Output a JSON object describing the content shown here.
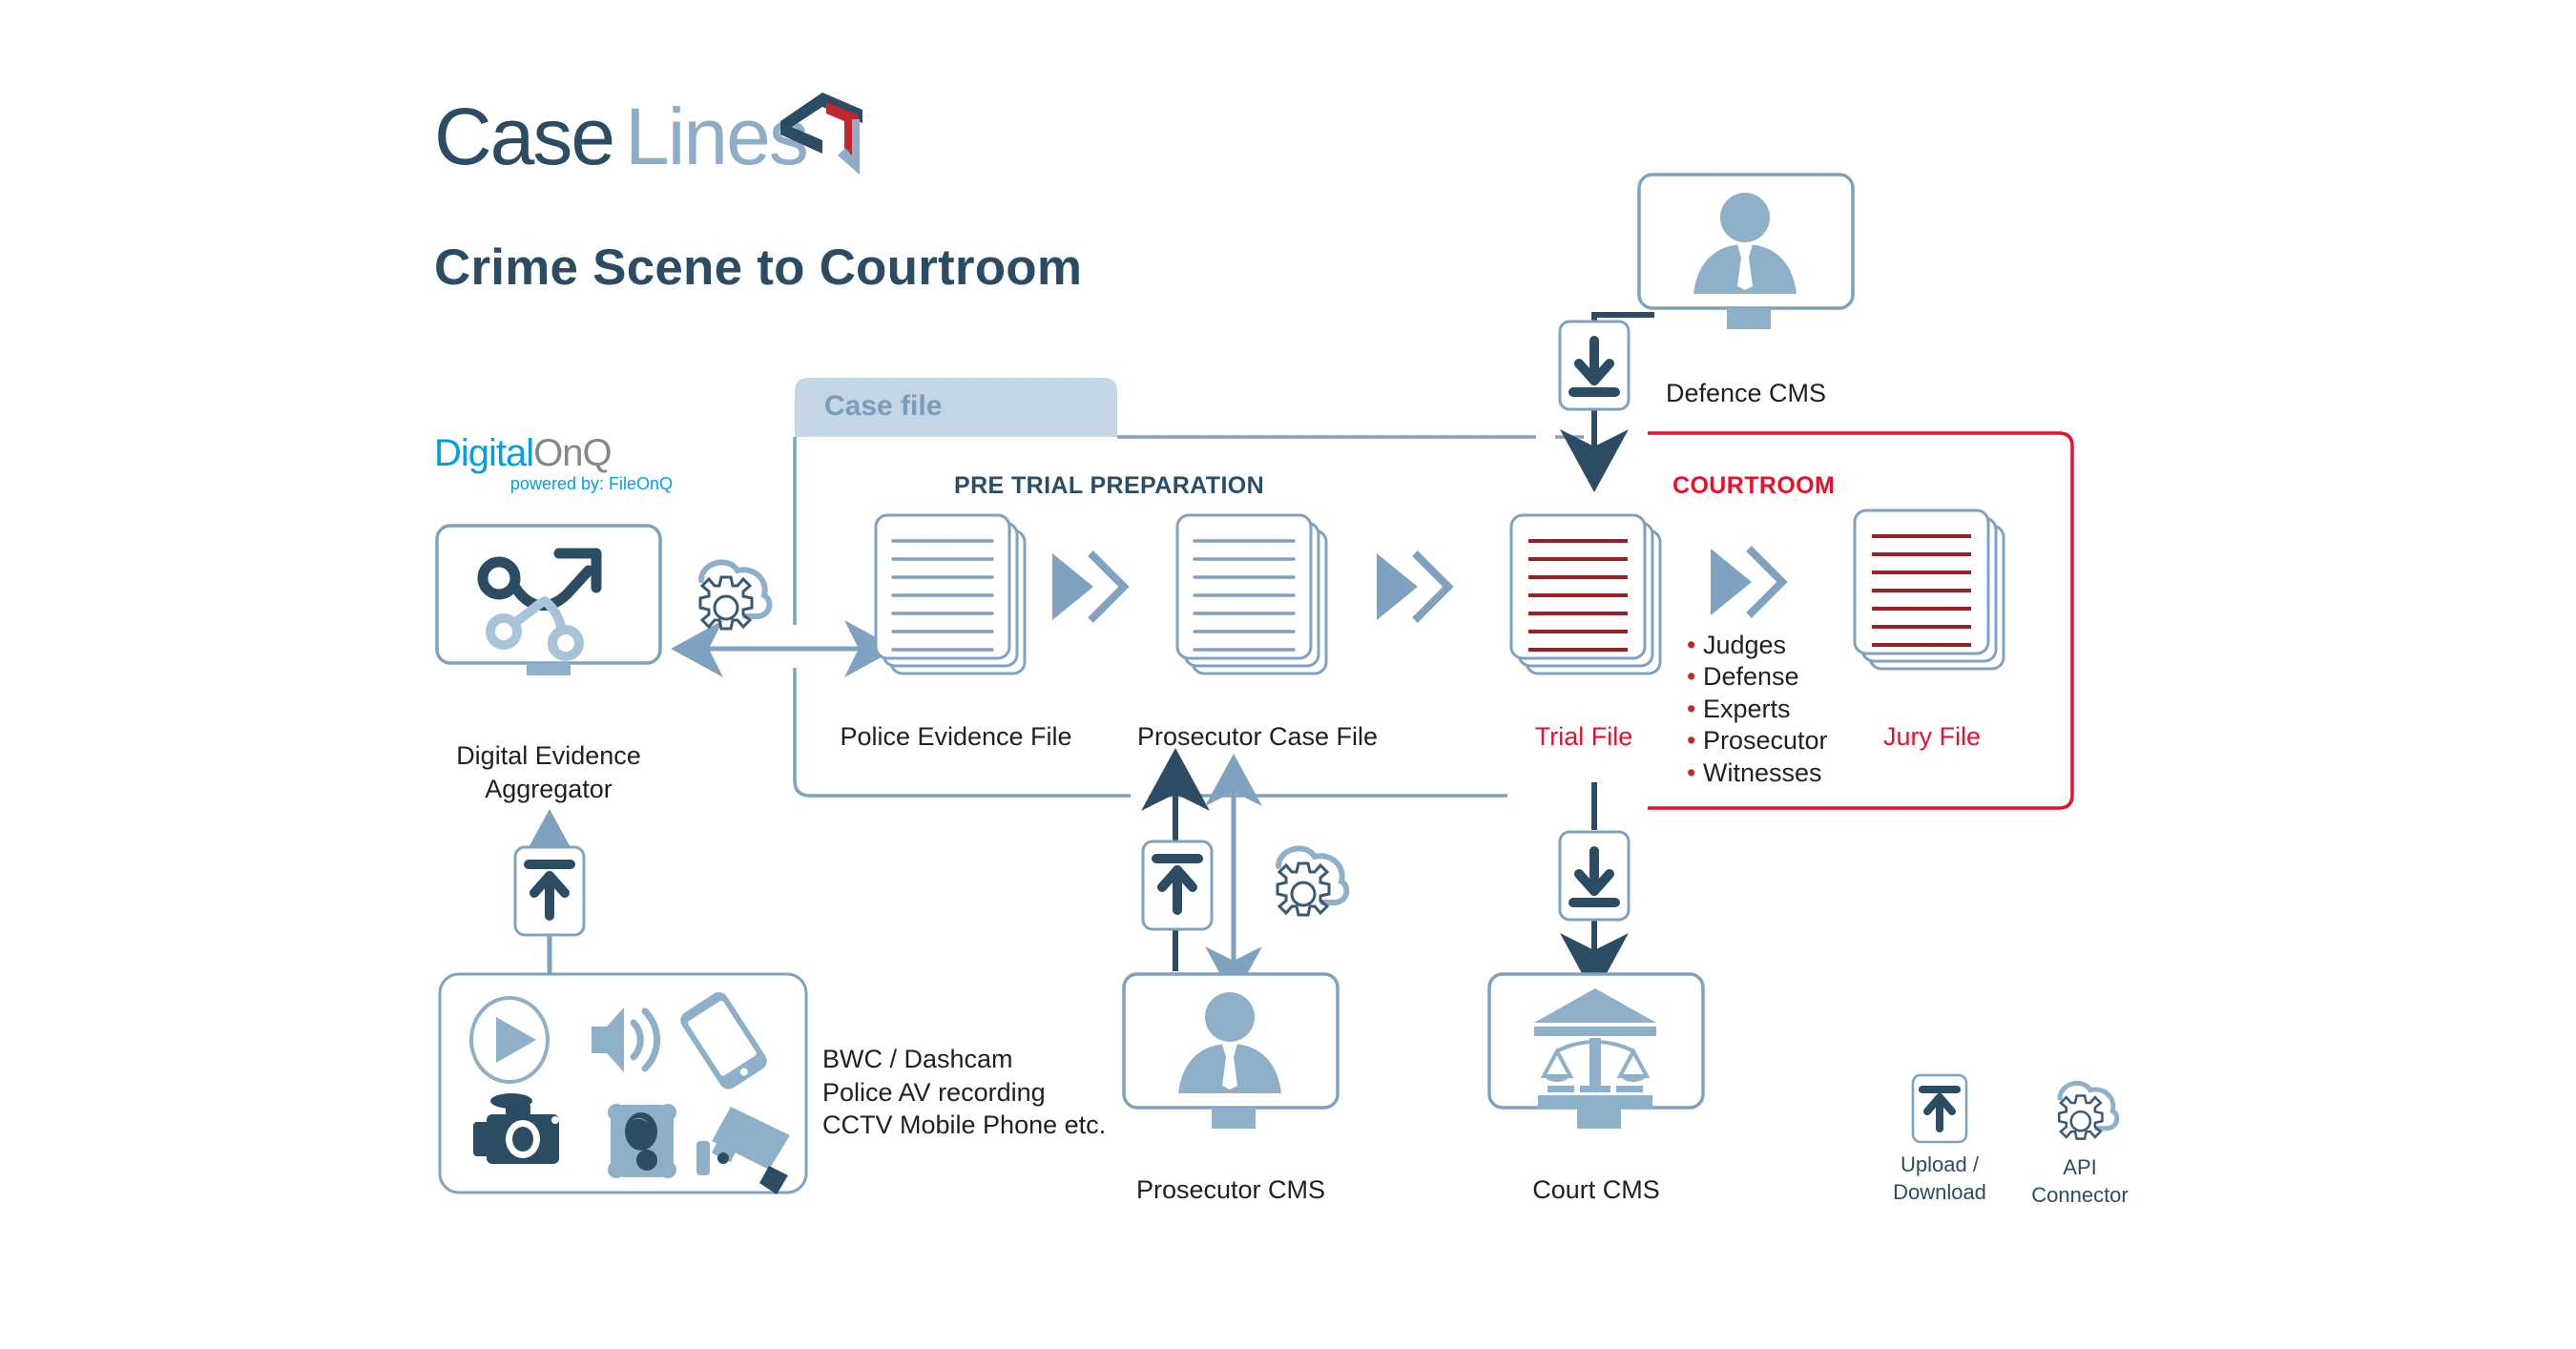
{
  "brand": {
    "logo_case": "Case",
    "logo_lines": "Lines",
    "logo_accent_color": "#c1272d",
    "logo_dark_color": "#2b4c63",
    "logo_light_color": "#8fadc6"
  },
  "page_title": "Crime Scene to Courtroom",
  "vendor_logo": {
    "part1": "Digital",
    "part2": "OnQ",
    "tagline": "powered by: FileOnQ",
    "part1_color": "#00a0e3",
    "part2_color": "#878787"
  },
  "case_file": {
    "tab_label": "Case file",
    "tab_bg": "#c4d5e4",
    "border_color": "#7fa2c0"
  },
  "sections": {
    "pre_trial": {
      "title": "PRE TRIAL PREPARATION",
      "color": "#2a4d69"
    },
    "courtroom": {
      "title": "COURTROOM",
      "color": "#e8112d"
    }
  },
  "nodes": {
    "aggregator": {
      "label": "Digital Evidence\nAggregator",
      "icon": "workflow-monitor-icon"
    },
    "police_file": {
      "label": "Police Evidence File",
      "icon": "document-stack-icon",
      "line_color": "#7fa2c0",
      "lines": 7
    },
    "prosecutor_file": {
      "label": "Prosecutor Case File",
      "icon": "document-stack-icon",
      "line_color": "#7fa2c0",
      "lines": 7
    },
    "trial_file": {
      "label": "Trial File",
      "icon": "document-stack-icon",
      "line_color": "#9c1f24",
      "text_color": "#e8112d",
      "lines": 7
    },
    "jury_file": {
      "label": "Jury File",
      "icon": "document-stack-icon",
      "line_color": "#9c1f24",
      "text_color": "#e8112d",
      "lines": 7
    },
    "defence_cms": {
      "label": "Defence CMS",
      "icon": "barrister-monitor-icon"
    },
    "prosecutor_cms": {
      "label": "Prosecutor CMS",
      "icon": "barrister-monitor-icon"
    },
    "court_cms": {
      "label": "Court CMS",
      "icon": "courthouse-scales-monitor-icon"
    }
  },
  "courtroom_participants": [
    "Judges",
    "Defense",
    "Experts",
    "Prosecutor",
    "Witnesses"
  ],
  "evidence_sources": {
    "note": "BWC / Dashcam\nPolice AV recording\nCCTV Mobile Phone etc.",
    "icons": [
      "video-play-icon",
      "audio-speaker-icon",
      "mobile-phone-icon",
      "camera-icon",
      "body-worn-camera-icon",
      "cctv-camera-icon"
    ]
  },
  "legend": [
    {
      "label": "Upload /\nDownload",
      "icon": "upload-download-icon"
    },
    {
      "label": "API\nConnector",
      "icon": "api-cloud-gear-icon"
    }
  ],
  "palette": {
    "dark_navy": "#2b4c63",
    "mid_blue": "#7fa2c0",
    "light_blue": "#a8c4d9",
    "red": "#e8112d",
    "dark_red": "#9c1f24",
    "tab_blue": "#c4d5e4"
  }
}
